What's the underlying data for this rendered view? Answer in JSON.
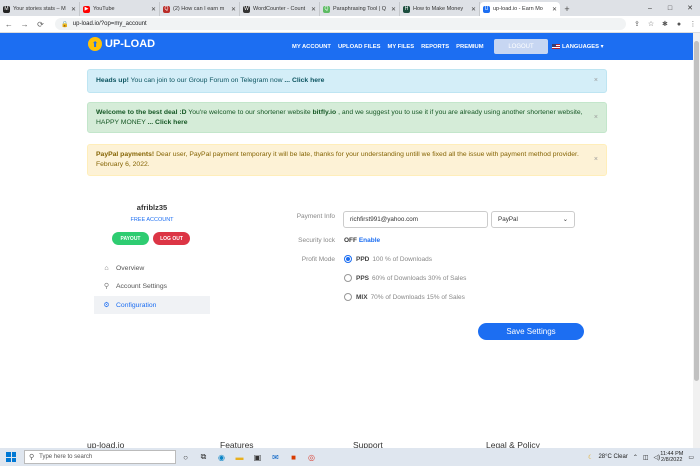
{
  "browser": {
    "tabs": [
      {
        "label": "Your stories stats – M",
        "fav_color": "#222222",
        "fav_glyph": "M"
      },
      {
        "label": "YouTube",
        "fav_color": "#ff0000",
        "fav_glyph": "▶"
      },
      {
        "label": "(2) How can I earn m",
        "fav_color": "#b92b27",
        "fav_glyph": "Q"
      },
      {
        "label": "WordCounter - Count",
        "fav_color": "#333333",
        "fav_glyph": "W"
      },
      {
        "label": "Paraphrasing Tool | Q",
        "fav_color": "#5dbb63",
        "fav_glyph": "Q"
      },
      {
        "label": "How to Make Money",
        "fav_color": "#1b4d3e",
        "fav_glyph": "H"
      },
      {
        "label": "up-load.io - Earn Mo",
        "fav_color": "#1c6ef2",
        "fav_glyph": "U"
      }
    ],
    "url": "up-load.io/?op=my_account"
  },
  "site": {
    "logo_text": "UP-LOAD",
    "menu": [
      "MY ACCOUNT",
      "UPLOAD FILES",
      "MY FILES",
      "REPORTS",
      "PREMIUM"
    ],
    "logout_label": "LOGOUT",
    "languages_label": "LANGUAGES ▾"
  },
  "alerts": {
    "a1": {
      "bold": "Heads up!",
      "text": " You can join to our Group Forum on Telegram now ",
      "link": "... Click here"
    },
    "a2": {
      "bold": "Welcome to the best deal :D",
      "text1": " You're welcome to our shortener website ",
      "site": "bitfly.io",
      "text2": " , and we suggest you to use it if you are already using another shortener website, HAPPY MONEY ",
      "link": "... Click here"
    },
    "a3": {
      "bold": "PayPal payments!",
      "text": " Dear user, PayPal payment temporary it will be late, thanks for your understanding untill we fixed all the issue with payment method provider. February 6, 2022."
    },
    "close": "×"
  },
  "profile": {
    "username": "afriblz35",
    "account_type": "FREE ACCOUNT",
    "payout_label": "PAYOUT",
    "logout_label": "LOG OUT",
    "menu": [
      {
        "label": "Overview",
        "icon": "⌂"
      },
      {
        "label": "Account Settings",
        "icon": "⚲"
      },
      {
        "label": "Configuration",
        "icon": "⚙"
      }
    ]
  },
  "form": {
    "payment_info_label": "Payment Info",
    "payment_email": "richfirst991@yahoo.com",
    "payment_method": "PayPal",
    "security_lock_label": "Security lock",
    "security_state": "OFF",
    "security_enable": "Enable",
    "profit_mode_label": "Profit Mode",
    "modes": [
      {
        "code": "PPD",
        "desc": "100 % of Downloads"
      },
      {
        "code": "PPS",
        "desc": "60% of Downloads  30% of Sales"
      },
      {
        "code": "MIX",
        "desc": "70% of Downloads  15% of Sales"
      }
    ],
    "selected_mode_index": 0,
    "save_label": "Save Settings"
  },
  "footer": [
    "up-load.io",
    "Features",
    "Support",
    "Legal & Policy"
  ],
  "taskbar": {
    "search_placeholder": "Type here to search",
    "weather": "28°C  Clear",
    "time": "11:44 PM",
    "date": "2/8/2022"
  }
}
